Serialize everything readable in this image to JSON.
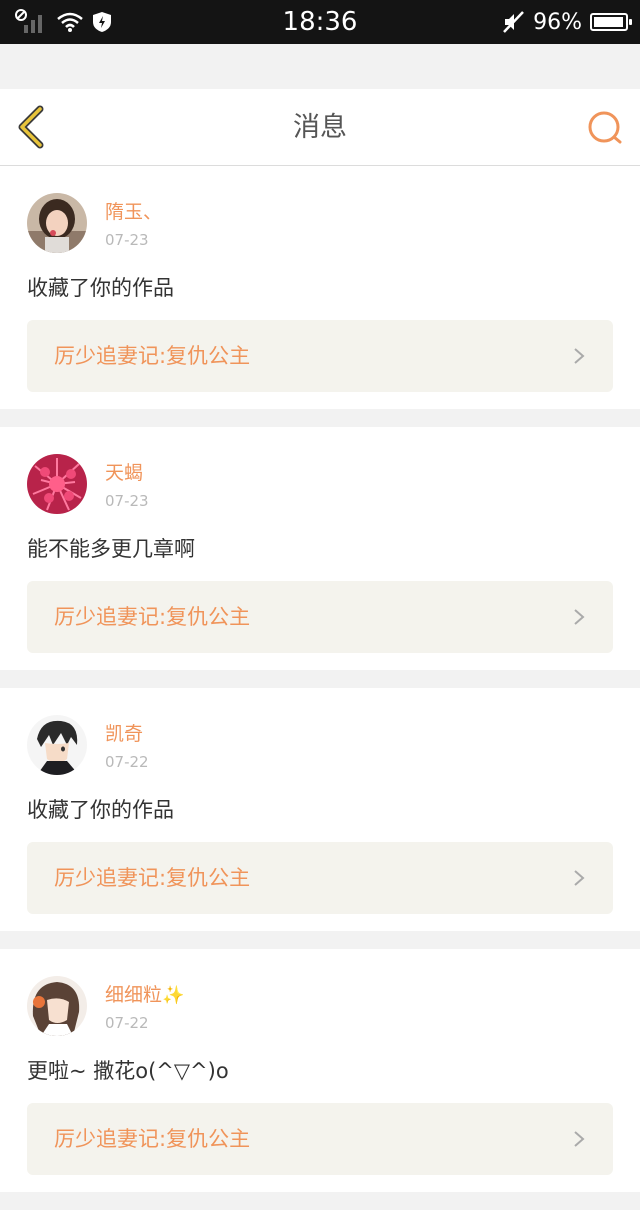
{
  "status_bar": {
    "time": "18:36",
    "battery_percent_label": "96%",
    "battery_level": 0.96
  },
  "header": {
    "title": "消息"
  },
  "colors": {
    "accent": "#f0945a",
    "back_icon": "#e8c43a",
    "card_bg": "#ffffff",
    "work_bg": "#f4f3ed"
  },
  "messages": [
    {
      "user": "隋玉、",
      "date": "07-23",
      "content": "收藏了你的作品",
      "work": "厉少追妻记:复仇公主",
      "avatar": "girl-avatar"
    },
    {
      "user": "天蝎",
      "date": "07-23",
      "content": "能不能多更几章啊",
      "work": "厉少追妻记:复仇公主",
      "avatar": "pink-flower-avatar"
    },
    {
      "user": "凯奇",
      "date": "07-22",
      "content": "收藏了你的作品",
      "work": "厉少追妻记:复仇公主",
      "avatar": "anime-boy-avatar"
    },
    {
      "user": "细细粒",
      "user_suffix": "✨",
      "date": "07-22",
      "content": "更啦~ 撒花o(^▽^)o",
      "work": "厉少追妻记:复仇公主",
      "avatar": "anime-girl-avatar"
    }
  ]
}
